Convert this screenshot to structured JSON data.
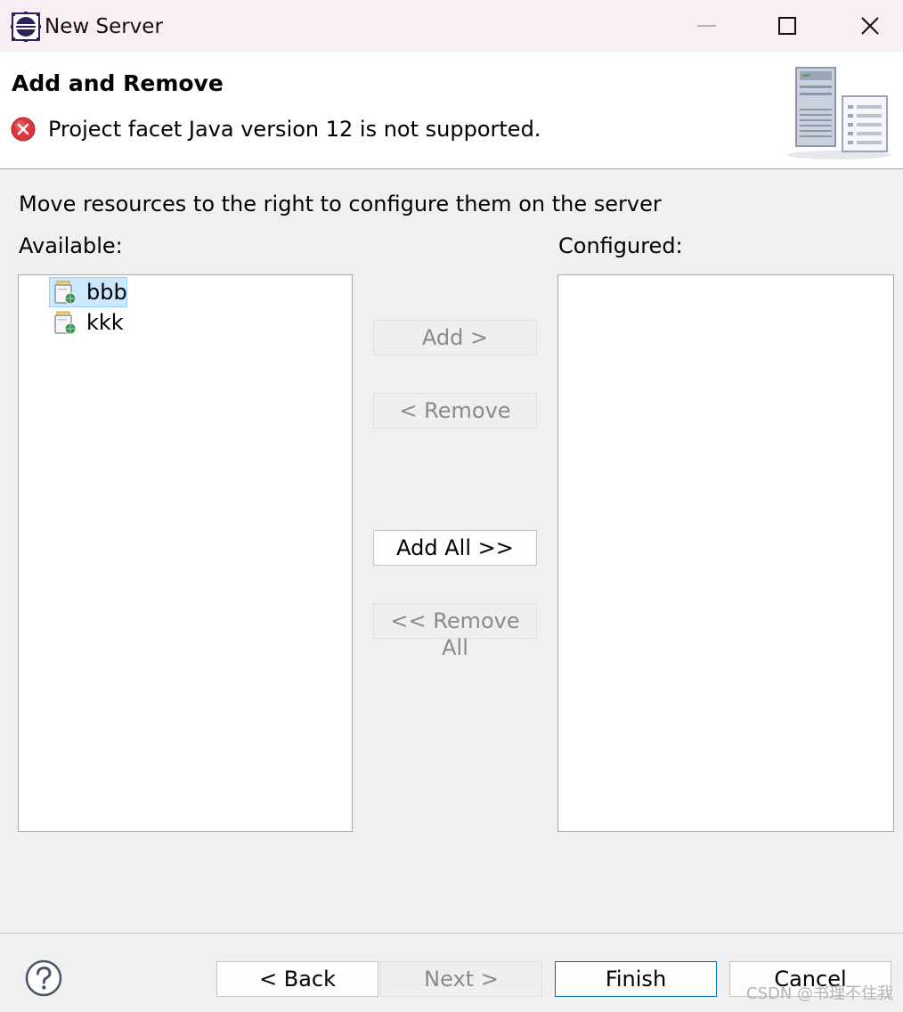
{
  "window": {
    "title": "New Server"
  },
  "banner": {
    "title": "Add and Remove",
    "error_message": "Project facet Java version 12 is not supported."
  },
  "main": {
    "instructions": "Move resources to the right to configure them on the server",
    "available_label": "Available:",
    "configured_label": "Configured:",
    "available_items": [
      {
        "label": "bbb",
        "selected": true
      },
      {
        "label": "kkk",
        "selected": false
      }
    ],
    "configured_items": []
  },
  "buttons": {
    "add": "Add >",
    "remove": "< Remove",
    "add_all": "Add All >>",
    "remove_all": "<< Remove All",
    "back": "< Back",
    "next": "Next >",
    "finish": "Finish",
    "cancel": "Cancel"
  },
  "watermark": "CSDN @书理不住我",
  "colors": {
    "titlebar_bg": "#f8eef4",
    "dialog_bg": "#f0f0f0",
    "selection_bg": "#cce8ff",
    "default_button_border": "#0067c0",
    "error_red": "#d9363e"
  },
  "icons": {
    "app": "eclipse-icon",
    "error": "error-icon",
    "banner": "server-wizard-icon",
    "project": "web-project-icon",
    "help": "help-icon"
  }
}
